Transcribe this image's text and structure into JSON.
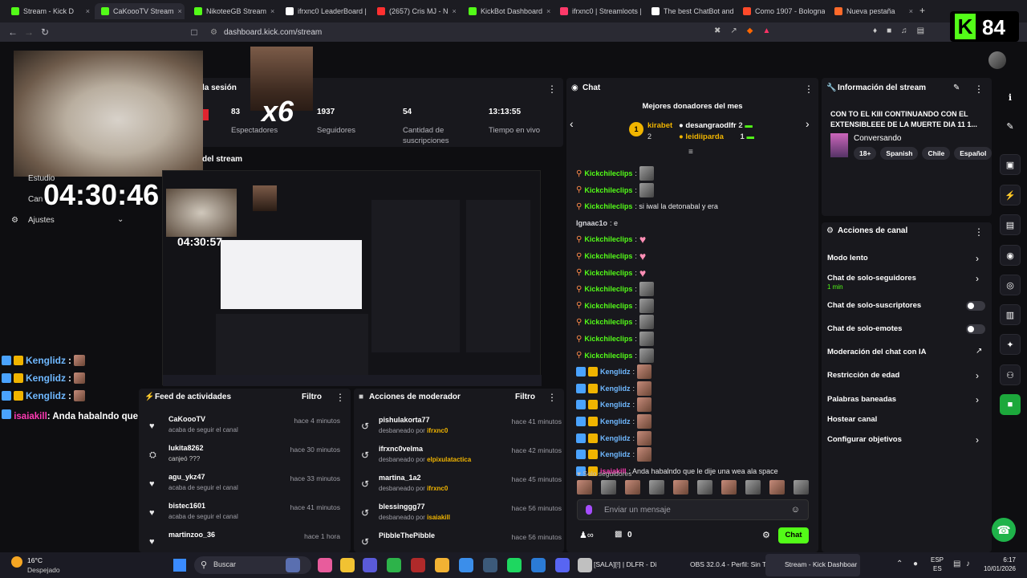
{
  "browser": {
    "tabs": [
      {
        "label": "Stream - Kick D",
        "color": "#53fc18"
      },
      {
        "label": "CaKoooTV Stream",
        "color": "#53fc18"
      },
      {
        "label": "NikoteeGB Stream",
        "color": "#53fc18"
      },
      {
        "label": "ifrxnc0 LeaderBoard |",
        "color": "#ffffff"
      },
      {
        "label": "(2657) Cris MJ - N",
        "color": "#ff3030"
      },
      {
        "label": "KickBot Dashboard",
        "color": "#53fc18"
      },
      {
        "label": "ifrxnc0 | Streamloots |",
        "color": "#ff3a6a"
      },
      {
        "label": "The best ChatBot and",
        "color": "#ffffff"
      },
      {
        "label": "Como 1907 - Bologna",
        "color": "#ff4a2a"
      },
      {
        "label": "Nueva pestaña",
        "color": "#ff6a2a"
      }
    ],
    "url": "dashboard.kick.com/stream",
    "new_tab": "+",
    "overlay_count": "84"
  },
  "stream_session": {
    "title_fragment": "la sesión",
    "viewers": "83",
    "viewers_label": "Espectadores",
    "followers": "1937",
    "followers_label": "Seguidores",
    "subs": "54",
    "subs_label": "Cantidad de suscripciones",
    "time": "13:13:55",
    "time_label": "Tiempo en vivo",
    "multiplier": "x6",
    "preview_label": "del stream"
  },
  "sidebar": {
    "items": [
      "Estudio",
      "Can",
      "Ajustes"
    ]
  },
  "overlay": {
    "timer": "04:30:46",
    "inner_timer": "04:30:57",
    "chat": [
      {
        "name": "Kenglidz",
        "text": ":"
      },
      {
        "name": "Kenglidz",
        "text": ":"
      },
      {
        "name": "Kenglidz",
        "text": ":"
      }
    ],
    "last_name": "isaiakill",
    "last_text": ": Anda habalndo que le dije una wea ala space"
  },
  "chat": {
    "title": "Chat",
    "donors_title": "Mejores donadores del mes",
    "donors": [
      {
        "rank": "1",
        "name": "kirabet",
        "value": "2"
      },
      {
        "name": "desangraodlfr",
        "value": "2"
      },
      {
        "name": "leidiiparda",
        "value": "1"
      }
    ],
    "messages": [
      {
        "name": "Kickchileclips",
        "text": ":"
      },
      {
        "name": "Kickchileclips",
        "text": ":"
      },
      {
        "name": "Kickchileclips",
        "text": ": si iwal la detonabal y era"
      },
      {
        "name": "Ignaac1o",
        "text": ": e"
      },
      {
        "name": "Kickchileclips",
        "text": ":"
      },
      {
        "name": "Kickchileclips",
        "text": ":"
      },
      {
        "name": "Kickchileclips",
        "text": ":"
      },
      {
        "name": "Kickchileclips",
        "text": ":"
      },
      {
        "name": "Kickchileclips",
        "text": ":"
      },
      {
        "name": "Kickchileclips",
        "text": ":"
      },
      {
        "name": "Kickchileclips",
        "text": ":"
      },
      {
        "name": "Kickchileclips",
        "text": ":"
      },
      {
        "name": "Kenglidz",
        "text": ":"
      },
      {
        "name": "Kenglidz",
        "text": ":"
      },
      {
        "name": "Kenglidz",
        "text": ":"
      },
      {
        "name": "Kenglidz",
        "text": ":"
      },
      {
        "name": "Kenglidz",
        "text": ":"
      },
      {
        "name": "Kenglidz",
        "text": ":"
      },
      {
        "name": "isaiakill",
        "text": ": Anda habalndo que le dije una wea ala space"
      }
    ],
    "followers_only": "Solo seguidores",
    "placeholder": "Enviar un mensaje",
    "points": "0",
    "send_label": "Chat"
  },
  "stream_info": {
    "title": "Información del stream",
    "stream_title": "CON TO EL KIII CONTINUANDO CON EL EXTENSIBLEEE DE LA MUERTE DIA 11 1...",
    "category": "Conversando",
    "tags": [
      "18+",
      "Spanish",
      "Chile",
      "Español"
    ]
  },
  "channel_actions": {
    "title": "Acciones de canal",
    "items": [
      {
        "label": "Modo lento",
        "sub": "",
        "kind": "arrow"
      },
      {
        "label": "Chat de solo-seguidores",
        "sub": "1 min",
        "kind": "arrow"
      },
      {
        "label": "Chat de solo-suscriptores",
        "sub": "",
        "kind": "toggle"
      },
      {
        "label": "Chat de solo-emotes",
        "sub": "",
        "kind": "toggle"
      },
      {
        "label": "Moderación del chat con IA",
        "sub": "",
        "kind": "external"
      },
      {
        "label": "Restricción de edad",
        "sub": "",
        "kind": "arrow"
      },
      {
        "label": "Palabras baneadas",
        "sub": "",
        "kind": "arrow"
      },
      {
        "label": "Hostear canal",
        "sub": "",
        "kind": "none"
      },
      {
        "label": "Configurar objetivos",
        "sub": "",
        "kind": "arrow"
      }
    ]
  },
  "activity_feed": {
    "title": "Feed de actividades",
    "filter": "Filtro",
    "rows": [
      {
        "name": "CaKoooTV",
        "sub": "acaba de seguir el canal",
        "time": "hace 4 minutos"
      },
      {
        "name": "lukita8262",
        "sub": "canjeó ???",
        "time": "hace 30 minutos"
      },
      {
        "name": "agu_ykz47",
        "sub": "acaba de seguir el canal",
        "time": "hace 33 minutos"
      },
      {
        "name": "bistec1601",
        "sub": "acaba de seguir el canal",
        "time": "hace 41 minutos"
      },
      {
        "name": "martinzoo_36",
        "sub": "",
        "time": "hace 1 hora"
      }
    ]
  },
  "mod_actions": {
    "title": "Acciones de moderador",
    "filter": "Filtro",
    "rows": [
      {
        "name": "pishulakorta77",
        "sub": "desbaneado por",
        "by": "ifrxnc0",
        "time": "hace 41 minutos"
      },
      {
        "name": "ifrxnc0velma",
        "sub": "desbaneado por",
        "by": "elpixulatactica",
        "time": "hace 42 minutos"
      },
      {
        "name": "martina_1a2",
        "sub": "desbaneado por",
        "by": "ifrxnc0",
        "time": "hace 45 minutos"
      },
      {
        "name": "blessinggg77",
        "sub": "desbaneado por",
        "by": "isaiakill",
        "time": "hace 56 minutos"
      },
      {
        "name": "PibbleThePibble",
        "sub": "",
        "by": "",
        "time": "hace 56 minutos"
      }
    ]
  },
  "taskbar": {
    "weather_temp": "16°C",
    "weather_desc": "Despejado",
    "search": "Buscar",
    "items": [
      "[SALA][!]  | DLFR - Di",
      "OBS 32.0.4 - Perfil: Sin T",
      "Stream - Kick Dashboar"
    ],
    "lang": "ESP",
    "lang2": "ES",
    "time": "6:17",
    "date": "10/01/2026"
  }
}
